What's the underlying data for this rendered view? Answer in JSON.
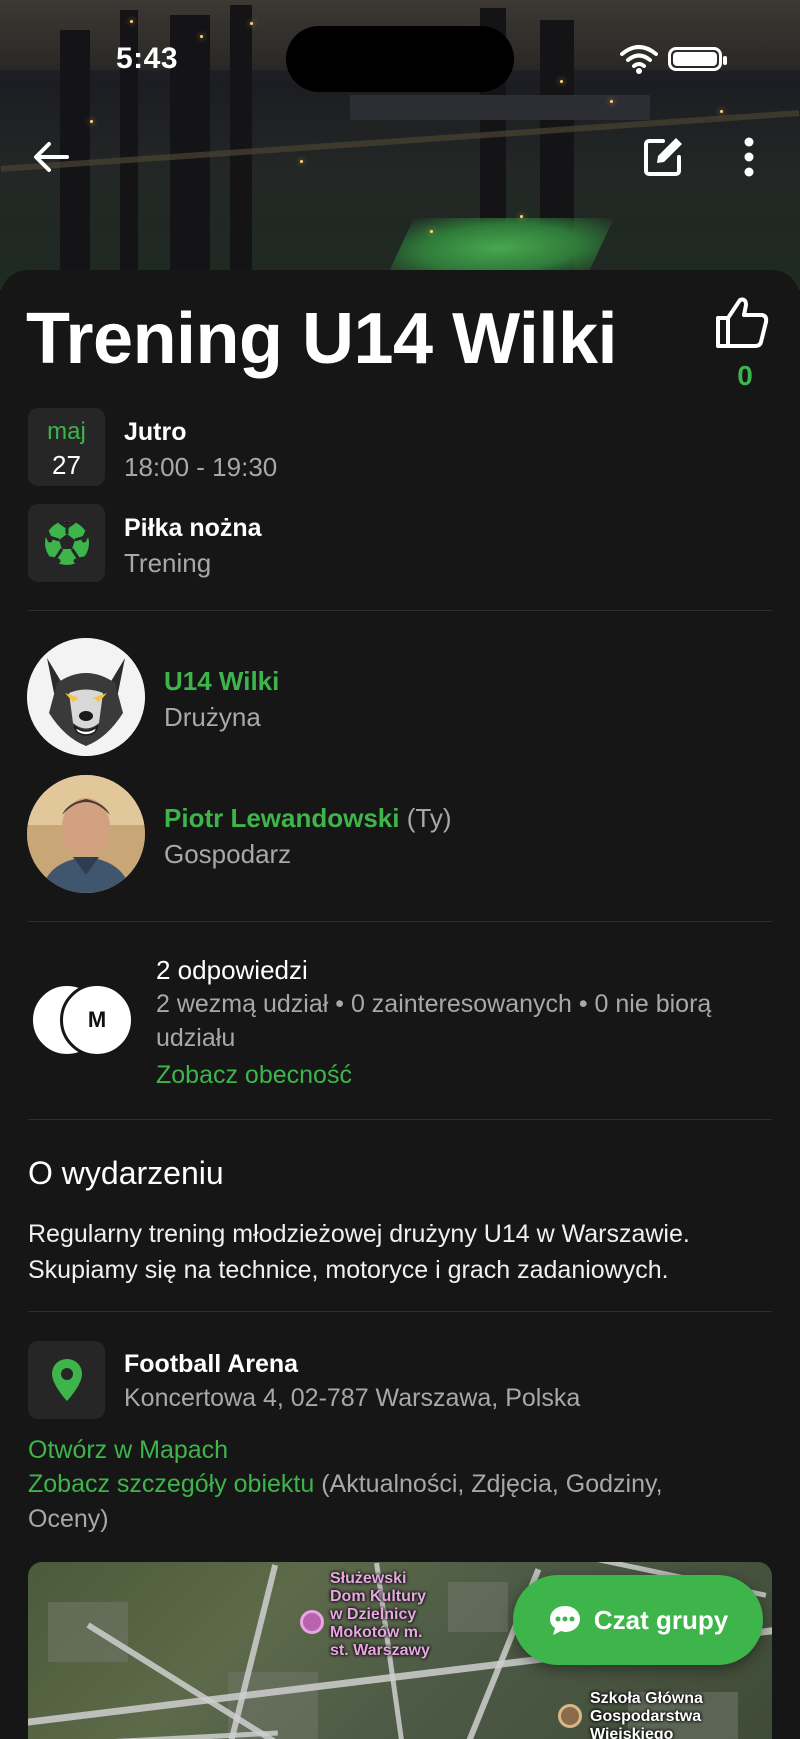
{
  "status_bar": {
    "time": "5:43"
  },
  "event": {
    "title": "Trening U14 Wilki",
    "likes": "0",
    "date": {
      "month": "maj",
      "day": "27",
      "label": "Jutro",
      "time_range": "18:00 - 19:30"
    },
    "sport": {
      "name": "Piłka nożna",
      "type": "Trening"
    }
  },
  "team": {
    "name": "U14 Wilki",
    "role": "Drużyna"
  },
  "host": {
    "name": "Piotr Lewandowski",
    "suffix": "(Ty)",
    "role": "Gospodarz"
  },
  "responses": {
    "title": "2 odpowiedzi",
    "summary_line1": "2 wezmą udział • 0 zainteresowanych • 0 nie biorą",
    "summary_line2": "udziału",
    "avatar_initial": "M",
    "link": "Zobacz obecność"
  },
  "about": {
    "heading": "O wydarzeniu",
    "text": "Regularny trening młodzieżowej drużyny U14 w Warszawie. Skupiamy się na technice, motoryce i grach zadaniowych."
  },
  "location": {
    "name": "Football Arena",
    "address": "Koncertowa 4, 02-787 Warszawa, Polska",
    "open_maps": "Otwórz w Mapach",
    "details_link": "Zobacz szczegóły obiektu",
    "details_extra_1": "(Aktualności, Zdjęcia, Godziny,",
    "details_extra_2": "Oceny)"
  },
  "map": {
    "poi1_lines": [
      "Służewski",
      "Dom Kultury",
      "w Dzielnicy",
      "Mokotów m.",
      "st. Warszawy"
    ],
    "poi2_lines": [
      "Szkoła Główna",
      "Gospodarstwa",
      "Wiejskiego"
    ]
  },
  "chat_button": {
    "label": "Czat grupy"
  },
  "colors": {
    "accent": "#3db54a",
    "background": "#161616",
    "tile": "#262626"
  }
}
